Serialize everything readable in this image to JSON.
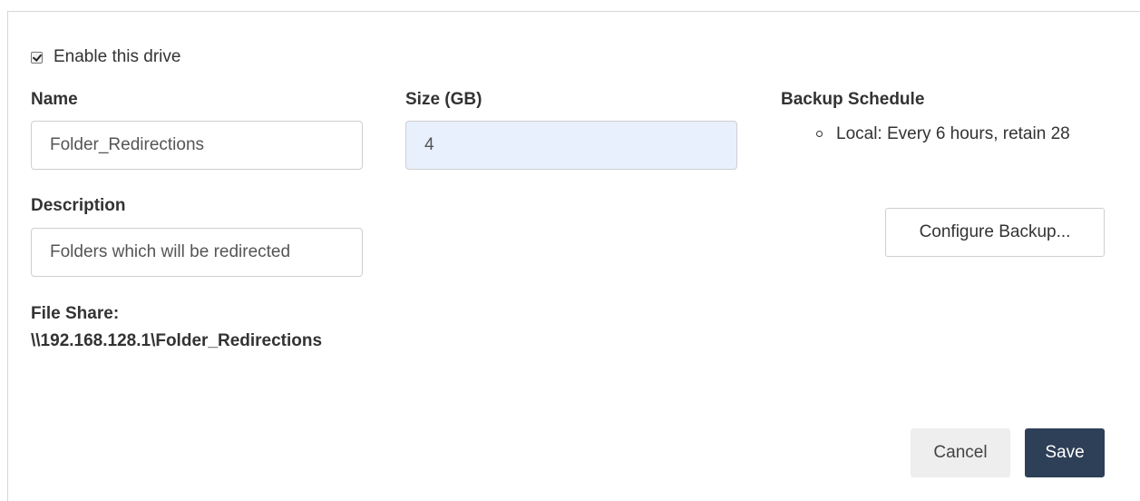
{
  "drive_form": {
    "enable_label": "Enable this drive",
    "enable_checked": true,
    "name": {
      "label": "Name",
      "value": "Folder_Redirections"
    },
    "size": {
      "label": "Size (GB)",
      "value": "4"
    },
    "description": {
      "label": "Description",
      "value": "Folders which will be redirected"
    },
    "file_share": {
      "label": "File Share:",
      "path": "\\\\192.168.128.1\\Folder_Redirections"
    },
    "backup": {
      "title": "Backup Schedule",
      "items": [
        {
          "text": "Local: Every 6 hours, retain 28",
          "icon": "circle-bullet-icon"
        }
      ],
      "configure_label": "Configure Backup..."
    },
    "actions": {
      "cancel_label": "Cancel",
      "save_label": "Save"
    }
  },
  "colors": {
    "save_button_bg": "#2e4057",
    "cancel_button_bg": "#eeeeee",
    "autofill_bg": "#e8f0fe"
  }
}
